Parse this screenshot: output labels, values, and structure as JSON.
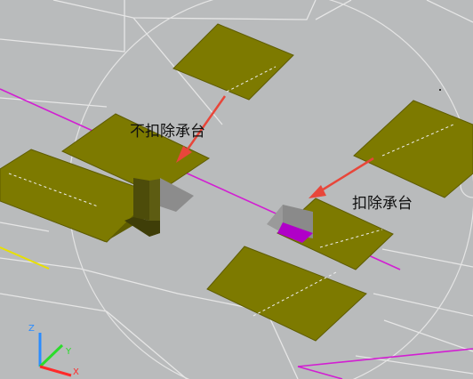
{
  "viewport": {
    "background": "#b9bbbc"
  },
  "annotations": {
    "no_deduct_label": "不扣除承台",
    "deduct_label": "扣除承台"
  },
  "axes": {
    "z_label": "Z",
    "y_label": "Y",
    "x_label": "X"
  },
  "colors": {
    "pile_cap": "#7d7a00",
    "pile_cap_edge": "#5e5c00",
    "column": "#6b6a12",
    "magenta_line": "#d21ed2",
    "arrow": "#e8463a",
    "grid_line": "#e6e6e6",
    "yellow_line": "#e8e000",
    "void_fill": "#b000c8"
  }
}
